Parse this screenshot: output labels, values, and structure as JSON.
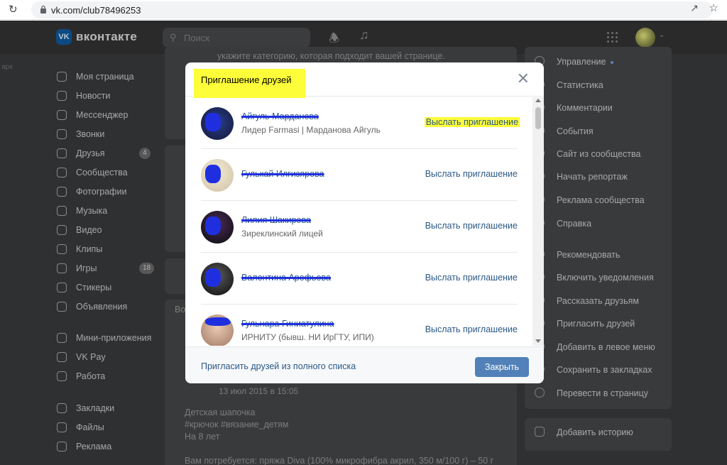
{
  "browser": {
    "url": "vk.com/club78496253"
  },
  "header": {
    "logo_text": "вконтакте",
    "logo_mark": "VK",
    "search_placeholder": "Поиск"
  },
  "left_nav": {
    "ghost": "арх",
    "items": [
      {
        "label": "Моя страница",
        "icon": "user-icon"
      },
      {
        "label": "Новости",
        "icon": "news-icon"
      },
      {
        "label": "Мессенджер",
        "icon": "messenger-icon"
      },
      {
        "label": "Звонки",
        "icon": "phone-icon"
      },
      {
        "label": "Друзья",
        "icon": "friends-icon",
        "badge": "4"
      },
      {
        "label": "Сообщества",
        "icon": "communities-icon"
      },
      {
        "label": "Фотографии",
        "icon": "photos-icon"
      },
      {
        "label": "Музыка",
        "icon": "music-icon"
      },
      {
        "label": "Видео",
        "icon": "video-icon"
      },
      {
        "label": "Клипы",
        "icon": "clips-icon"
      },
      {
        "label": "Игры",
        "icon": "games-icon",
        "badge": "18"
      },
      {
        "label": "Стикеры",
        "icon": "stickers-icon"
      },
      {
        "label": "Объявления",
        "icon": "ads-icon"
      },
      {
        "label": "Мини-приложения",
        "icon": "apps-icon"
      },
      {
        "label": "VK Pay",
        "icon": "vkpay-icon"
      },
      {
        "label": "Работа",
        "icon": "work-icon"
      },
      {
        "label": "Закладки",
        "icon": "bookmarks-icon"
      },
      {
        "label": "Файлы",
        "icon": "files-icon"
      },
      {
        "label": "Реклама",
        "icon": "advert-icon"
      }
    ]
  },
  "middle": {
    "top_text": "укажите категорию, которая подходит вашей странице.",
    "tab_fragment": "Во",
    "post_date": "13 июл 2015 в 15:05",
    "post_lines": [
      "Детская шапочка",
      "#крючок #вязание_детям",
      "На 8 лет",
      "",
      "Вам потребуется: пряжа Diva (100% микрофибра акрил, 350 м/100 г) – 50 г"
    ]
  },
  "right_menu": {
    "items": [
      {
        "label": "Управление",
        "dot": true
      },
      {
        "label": "Статистика"
      },
      {
        "label": "Комментарии"
      },
      {
        "label": "События"
      },
      {
        "label": "Сайт из сообщества"
      },
      {
        "label": "Начать репортаж"
      },
      {
        "label": "Реклама сообщества"
      },
      {
        "label": "Справка"
      },
      {
        "label": "Рекомендовать"
      },
      {
        "label": "Включить уведомления"
      },
      {
        "label": "Рассказать друзьям"
      },
      {
        "label": "Пригласить друзей"
      },
      {
        "label": "Добавить в левое меню"
      },
      {
        "label": "Сохранить в закладках"
      },
      {
        "label": "Перевести в страницу"
      }
    ],
    "story": "Добавить историю"
  },
  "modal": {
    "title": "Приглашение друзей",
    "close_label": "Закрыть",
    "full_list_link": "Пригласить друзей из полного списка",
    "friends": [
      {
        "name": "Айгуль Марданова",
        "sub": "Лидер Farmasi | Марданова Айгуль",
        "action": "Выслать приглашение",
        "highlight": true
      },
      {
        "name": "Гулькай Илгизярова",
        "sub": "",
        "action": "Выслать приглашение",
        "highlight": false
      },
      {
        "name": "Лилия Шакирова",
        "sub": "Зиреклинский лицей",
        "action": "Выслать приглашение",
        "highlight": false
      },
      {
        "name": "Валентина Арефьева",
        "sub": "",
        "action": "Выслать приглашение",
        "highlight": false
      },
      {
        "name": "Гульнара Гиниатулина",
        "sub": "ИРНИТУ (бывш. НИ ИрГТУ, ИПИ)",
        "action": "Выслать приглашение",
        "highlight": false
      }
    ]
  }
}
